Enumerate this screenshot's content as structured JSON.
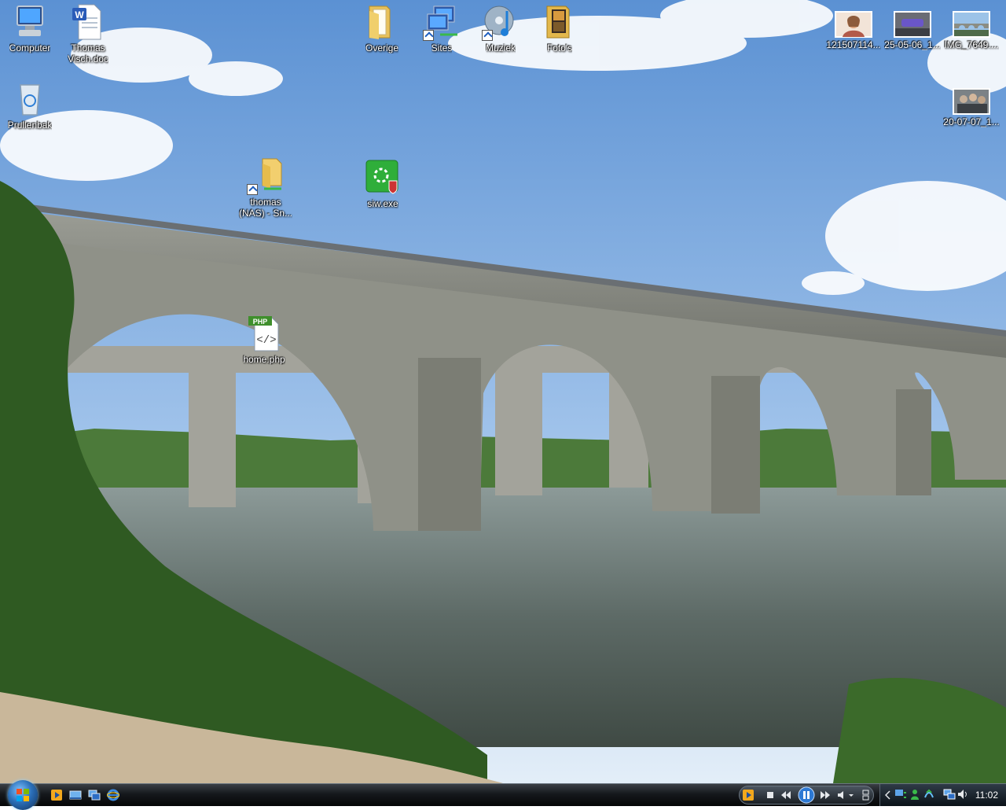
{
  "desktop": {
    "icons": [
      {
        "id": "computer",
        "label": "Computer"
      },
      {
        "id": "doc",
        "label": "Thomas\nVisch.doc"
      },
      {
        "id": "recycle",
        "label": "Prullenbak"
      },
      {
        "id": "overige",
        "label": "Overige"
      },
      {
        "id": "sites",
        "label": "Sites"
      },
      {
        "id": "muziek",
        "label": "Muziek"
      },
      {
        "id": "fotos",
        "label": "Foto's"
      },
      {
        "id": "nas",
        "label": "thomas\n(NAS) - Sn..."
      },
      {
        "id": "siw",
        "label": "siw.exe"
      },
      {
        "id": "php",
        "label": "home.php"
      },
      {
        "id": "img1",
        "label": "121507114..."
      },
      {
        "id": "img2",
        "label": "25-05-06_1..."
      },
      {
        "id": "img3",
        "label": "IMG_7649...."
      },
      {
        "id": "img4",
        "label": "20-07-07_1..."
      }
    ],
    "php_badge": "PHP"
  },
  "taskbar": {
    "clock": "11:02"
  },
  "colors": {
    "sky_top": "#5f95d6",
    "sky_bottom": "#d6e6f5",
    "stone": "#8b8d84",
    "water": "#5f6b6a",
    "grass": "#3d6b2a",
    "accent": "#3d8be0"
  }
}
